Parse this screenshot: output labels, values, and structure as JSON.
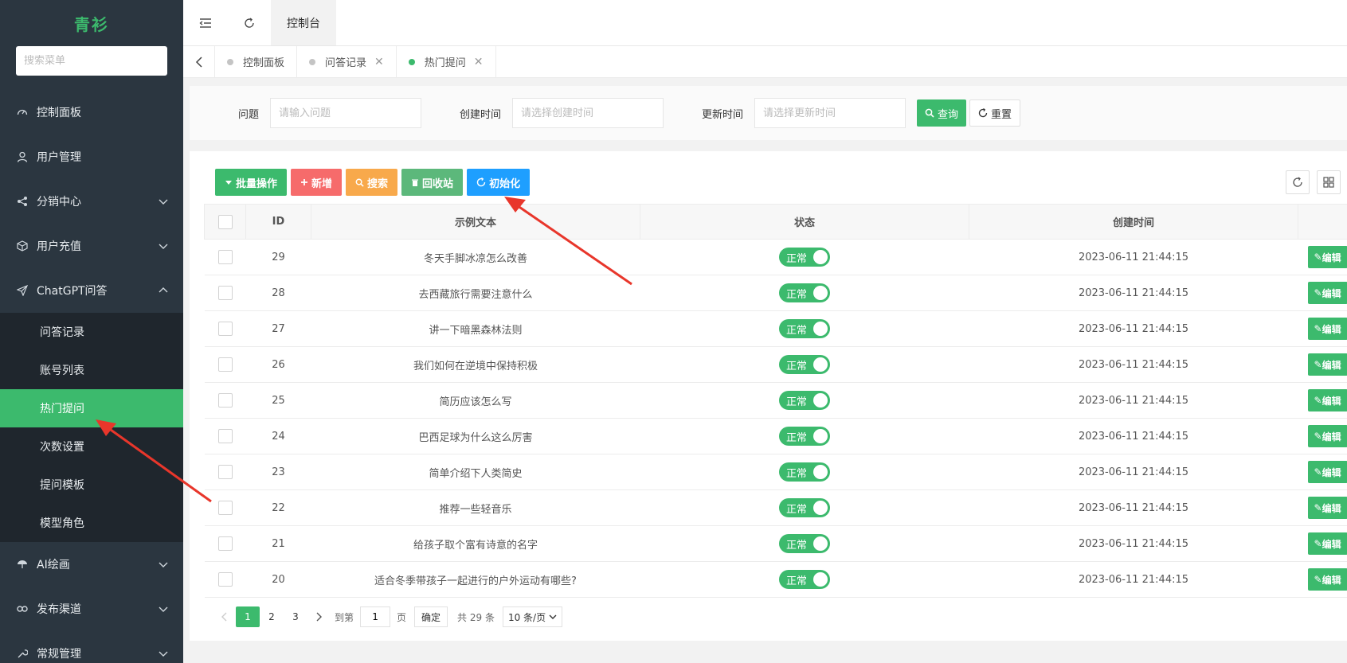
{
  "sidebar": {
    "logo": "青衫",
    "search_placeholder": "搜索菜单",
    "items": [
      {
        "label": "控制面板",
        "icon": "dashboard-icon",
        "expanded": null
      },
      {
        "label": "用户管理",
        "icon": "user-icon",
        "expanded": null
      },
      {
        "label": "分销中心",
        "icon": "share-icon",
        "expanded": false
      },
      {
        "label": "用户充值",
        "icon": "box-icon",
        "expanded": false
      },
      {
        "label": "ChatGPT问答",
        "icon": "send-icon",
        "expanded": true
      },
      {
        "label": "AI绘画",
        "icon": "umbrella-icon",
        "expanded": false
      },
      {
        "label": "发布渠道",
        "icon": "link-icon",
        "expanded": false
      },
      {
        "label": "常规管理",
        "icon": "tool-icon",
        "expanded": false
      }
    ],
    "subitems": [
      "问答记录",
      "账号列表",
      "热门提问",
      "次数设置",
      "提问模板",
      "模型角色"
    ],
    "active_sub": "热门提问"
  },
  "header": {
    "tab": "控制台"
  },
  "tabs": [
    {
      "label": "控制面板",
      "closable": false,
      "active": false
    },
    {
      "label": "问答记录",
      "closable": true,
      "active": false
    },
    {
      "label": "热门提问",
      "closable": true,
      "active": true
    }
  ],
  "filter": {
    "question_label": "问题",
    "question_placeholder": "请输入问题",
    "created_label": "创建时间",
    "created_placeholder": "请选择创建时间",
    "updated_label": "更新时间",
    "updated_placeholder": "请选择更新时间",
    "query_button": "查询",
    "reset_button": "重置"
  },
  "toolbar": {
    "batch": "批量操作",
    "add": "新增",
    "search": "搜索",
    "recycle": "回收站",
    "init": "初始化"
  },
  "table": {
    "headers": {
      "id": "ID",
      "text": "示例文本",
      "status": "状态",
      "created": "创建时间"
    },
    "rows": [
      {
        "id": "29",
        "text": "冬天手脚冰凉怎么改善",
        "status": "正常",
        "created": "2023-06-11 21:44:15"
      },
      {
        "id": "28",
        "text": "去西藏旅行需要注意什么",
        "status": "正常",
        "created": "2023-06-11 21:44:15"
      },
      {
        "id": "27",
        "text": "讲一下暗黑森林法则",
        "status": "正常",
        "created": "2023-06-11 21:44:15"
      },
      {
        "id": "26",
        "text": "我们如何在逆境中保持积极",
        "status": "正常",
        "created": "2023-06-11 21:44:15"
      },
      {
        "id": "25",
        "text": "简历应该怎么写",
        "status": "正常",
        "created": "2023-06-11 21:44:15"
      },
      {
        "id": "24",
        "text": "巴西足球为什么这么厉害",
        "status": "正常",
        "created": "2023-06-11 21:44:15"
      },
      {
        "id": "23",
        "text": "简单介绍下人类简史",
        "status": "正常",
        "created": "2023-06-11 21:44:15"
      },
      {
        "id": "22",
        "text": "推荐一些轻音乐",
        "status": "正常",
        "created": "2023-06-11 21:44:15"
      },
      {
        "id": "21",
        "text": "给孩子取个富有诗意的名字",
        "status": "正常",
        "created": "2023-06-11 21:44:15"
      },
      {
        "id": "20",
        "text": "适合冬季带孩子一起进行的户外运动有哪些?",
        "status": "正常",
        "created": "2023-06-11 21:44:15"
      }
    ],
    "edit_label": "编辑"
  },
  "pagination": {
    "pages": [
      "1",
      "2",
      "3"
    ],
    "current": "1",
    "goto_label": "到第",
    "goto_value": "1",
    "page_label": "页",
    "confirm": "确定",
    "total": "共 29 条",
    "per_page": "10 条/页"
  },
  "colors": {
    "accent": "#3cba6d",
    "sidebar": "#2b3640",
    "arrow": "#e8362b"
  }
}
